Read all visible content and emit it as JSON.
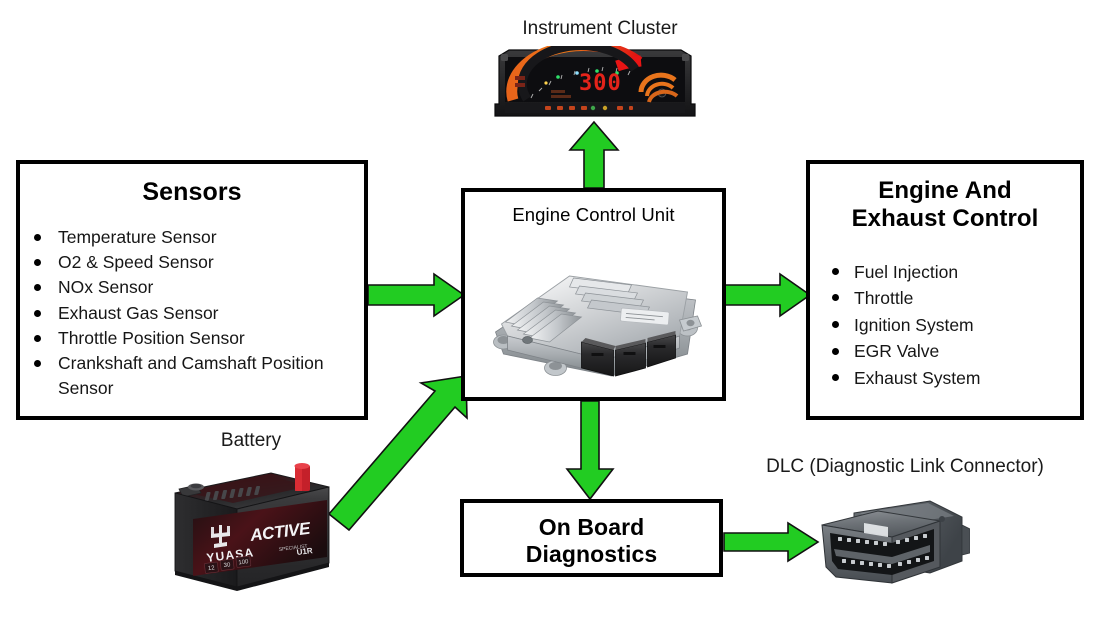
{
  "diagram": {
    "title_implicit": "Engine Control Unit system diagram",
    "accent_color": "#22CC22",
    "arrow_outline_color": "#111111",
    "box_border_color": "#000000",
    "background_color": "#FFFFFF"
  },
  "nodes": {
    "sensors": {
      "title": "Sensors",
      "items": [
        "Temperature Sensor",
        "O2 & Speed Sensor",
        "NOx Sensor",
        "Exhaust Gas Sensor",
        "Throttle Position Sensor",
        "Crankshaft and Camshaft Position Sensor"
      ]
    },
    "ecu": {
      "title": "Engine Control Unit",
      "image_name": "engine-control-unit-module"
    },
    "engine_exhaust": {
      "title": "Engine And Exhaust Control",
      "title_line1": "Engine And",
      "title_line2": "Exhaust Control",
      "items": [
        "Fuel Injection",
        "Throttle",
        "Ignition System",
        "EGR Valve",
        "Exhaust System"
      ]
    },
    "obd": {
      "title": "On Board Diagnostics",
      "title_line1": "On Board",
      "title_line2": "Diagnostics"
    },
    "instrument_cluster": {
      "label": "Instrument Cluster",
      "image_name": "instrument-cluster-gauge",
      "display_value": "300"
    },
    "battery": {
      "label": "Battery",
      "image_name": "car-battery",
      "brand": "YUASA",
      "product_line": "ACTIVE",
      "model_code": "U1R",
      "spec_values": [
        "12",
        "30",
        "100"
      ]
    },
    "dlc": {
      "label": "DLC (Diagnostic Link Connector)",
      "image_name": "obd-ii-connector"
    }
  },
  "connections": [
    {
      "name": "sensors-to-ecu",
      "from": "Sensors",
      "to": "Engine Control Unit",
      "direction": "right"
    },
    {
      "name": "ecu-to-engine-exhaust",
      "from": "Engine Control Unit",
      "to": "Engine And Exhaust Control",
      "direction": "right"
    },
    {
      "name": "ecu-to-instrument-cluster",
      "from": "Engine Control Unit",
      "to": "Instrument Cluster",
      "direction": "up"
    },
    {
      "name": "ecu-to-obd",
      "from": "Engine Control Unit",
      "to": "On Board Diagnostics",
      "direction": "down"
    },
    {
      "name": "battery-to-ecu",
      "from": "Battery",
      "to": "Engine Control Unit",
      "direction": "diagonal-up-right"
    },
    {
      "name": "obd-to-dlc",
      "from": "On Board Diagnostics",
      "to": "DLC (Diagnostic Link Connector)",
      "direction": "right"
    }
  ]
}
